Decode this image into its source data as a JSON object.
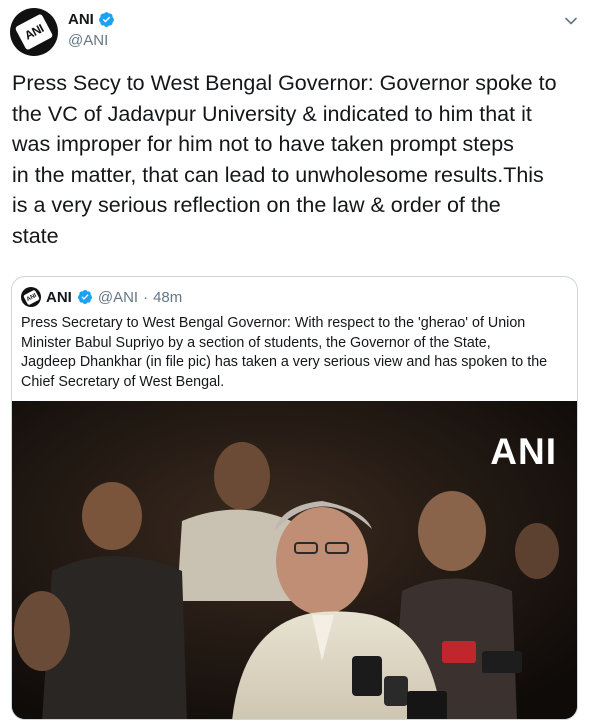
{
  "author": {
    "display_name": "ANI",
    "handle": "@ANI",
    "avatar_text": "ANI"
  },
  "tweet": {
    "text": "Press Secy to West Bengal Governor: Governor spoke to\nthe VC of Jadavpur University & indicated to him that it\nwas improper for him not to have taken prompt steps\nin the matter, that can lead to unwholesome results.This\nis a very serious reflection on the law & order of the\nstate"
  },
  "quoted": {
    "display_name": "ANI",
    "handle": "@ANI",
    "dot": "·",
    "time": "48m",
    "avatar_text": "ANI",
    "text": "Press Secretary to West Bengal Governor: With respect to the 'gherao' of Union\nMinister Babul Supriyo by a section of students, the Governor of the State,\nJagdeep Dhankhar (in file pic) has taken a very serious view and has spoken to the\nChief Secretary of West Bengal.",
    "media_watermark": "ANI"
  },
  "icons": {
    "verified": "verified-badge-icon",
    "menu": "chevron-down-icon"
  },
  "colors": {
    "verified_blue": "#1da1f2",
    "text": "#14171a",
    "secondary": "#657786",
    "border": "#ccd6dd"
  }
}
